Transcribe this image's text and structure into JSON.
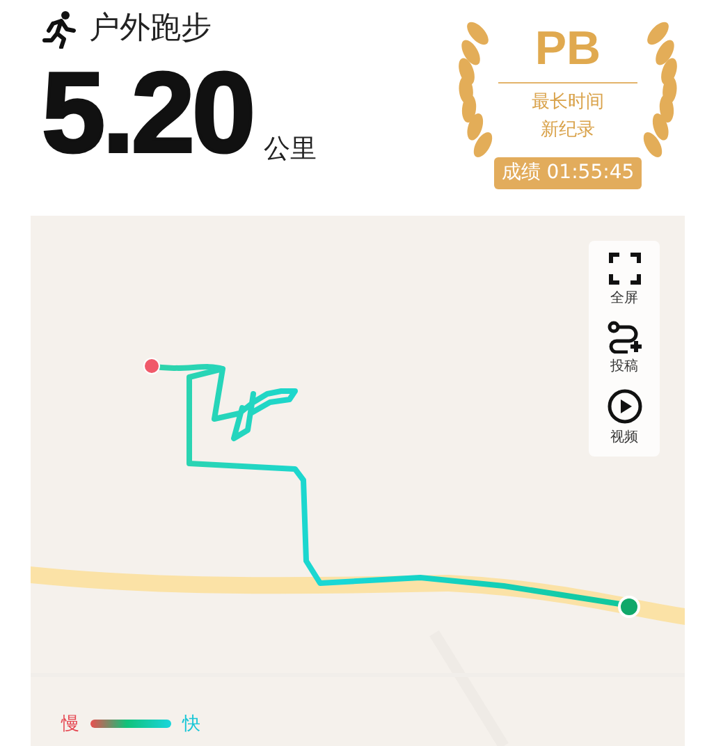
{
  "activity": {
    "title": "户外跑步",
    "distance": "5.20",
    "unit": "公里"
  },
  "badge": {
    "tag": "PB",
    "lines": [
      "最长时间",
      "新纪录"
    ],
    "result": "成绩 01:55:45"
  },
  "map": {
    "tools": [
      {
        "kind": "fullscreen",
        "label": "全屏"
      },
      {
        "kind": "share",
        "label": "投稿"
      },
      {
        "kind": "video",
        "label": "视频"
      }
    ],
    "legend": {
      "slow": "慢",
      "fast": "快"
    }
  }
}
